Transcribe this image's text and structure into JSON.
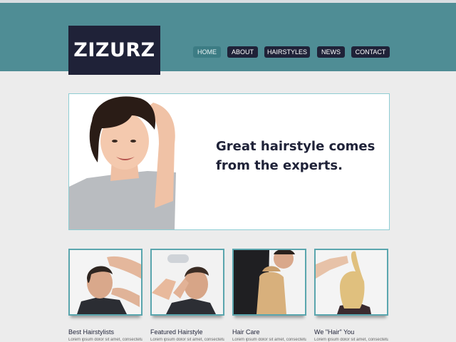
{
  "brand": {
    "logo_text": "ZIZURZ"
  },
  "nav": {
    "items": [
      {
        "label": "HOME",
        "active": true
      },
      {
        "label": "ABOUT",
        "active": false
      },
      {
        "label": "HAIRSTYLES",
        "active": false
      },
      {
        "label": "NEWS",
        "active": false
      },
      {
        "label": "CONTACT",
        "active": false
      }
    ]
  },
  "hero": {
    "headline_line1": "Great hairstyle comes",
    "headline_line2": "from the experts."
  },
  "features": [
    {
      "title": "Best Hairstylists",
      "text": "Lorem ipsum dolor sit amet, consectetur"
    },
    {
      "title": "Featured Hairstyle",
      "text": "Lorem ipsum dolor sit amet, consectetur"
    },
    {
      "title": "Hair Care",
      "text": "Lorem ipsum dolor sit amet, consectetur"
    },
    {
      "title": "We \"Hair\" You",
      "text": "Lorem ipsum dolor sit amet, consectetur"
    }
  ],
  "colors": {
    "header": "#4f8d95",
    "navy": "#1f2238",
    "active_nav": "#3c7c84",
    "border": "#5aa6ae"
  }
}
